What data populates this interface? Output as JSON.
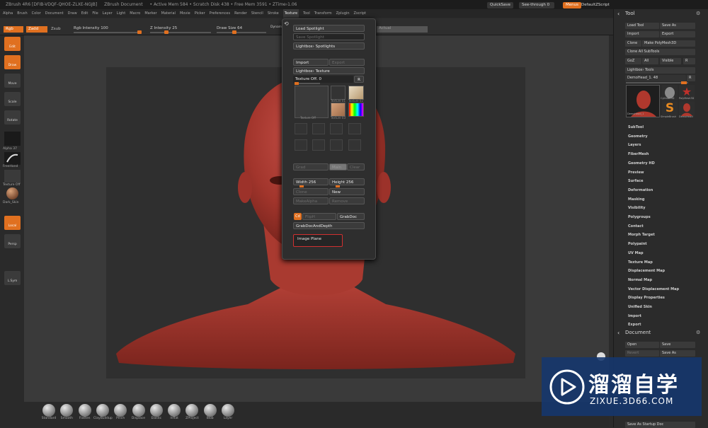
{
  "title_bar": {
    "app": "ZBrush 4R6 [DFIB-VDQF-QHOE-ZLXE-NGJB]",
    "document": "ZBrush Document",
    "stats": "• Active Mem 584 • Scratch Disk 438 • Free Mem 3591 • ZTime›1.06",
    "quicksave": "QuickSave",
    "see_through": "See-through 0",
    "menus": "Menus",
    "default_script": "DefaultZScript"
  },
  "menu_bar": [
    "Alpha",
    "Brush",
    "Color",
    "Document",
    "Draw",
    "Edit",
    "File",
    "Layer",
    "Light",
    "Macro",
    "Marker",
    "Material",
    "Movie",
    "Picker",
    "Preferences",
    "Render",
    "Stencil",
    "Stroke",
    "Texture",
    "Tool",
    "Transform",
    "Zplugin",
    "Zscript"
  ],
  "menu_active": "Texture",
  "toolbar": {
    "rgb": "Rgb",
    "mrgb": "Mrgb",
    "zadd": "Zadd",
    "zsub": "Zsub",
    "zcut": "Zcut",
    "rgb_intensity": "Rgb Intensity 100",
    "z_intensity": "Z Intensity 25",
    "draw_size": "Draw Size 64",
    "dynamic": "Dynamic",
    "focal": "Fo",
    "actual": "Actual"
  },
  "left_shelf": {
    "edit": "Edit",
    "draw": "Draw",
    "move": "Move",
    "scale": "Scale",
    "rotate": "Rotate",
    "alpha": "Alpha 37",
    "freehand": "FreeHand",
    "texture": "Texture Off",
    "material": "Dark_Skin",
    "local": "Local",
    "persp": "Persp",
    "lsym": "L.Sym"
  },
  "texture_popup": {
    "load_spotlight": "Load Spotlight",
    "save_spotlight": "Save Spotlight",
    "lightbox_spotlights": "Lightbox› Spotlights",
    "import": "Import",
    "export": "Export",
    "lightbox_texture": "Lightbox› Texture",
    "texture_off": "Texture Off. 0",
    "r": "R",
    "thumb_labels": [
      "Texture Off",
      "Texture 01",
      "Texture 02",
      "Texture 03"
    ],
    "grad": "Grad",
    "main": "Main",
    "clear": "Clear",
    "width": "Width 256",
    "height": "Height 256",
    "clone": "Clone",
    "new": "New",
    "make_alpha": "MakeAlpha",
    "remove": "Remove",
    "cd": "Cd",
    "flip_h": "FlipH",
    "grab_doc": "GrabDoc",
    "grab_doc_depth": "GrabDocAndDepth",
    "image_plane": "Image Plane"
  },
  "bottom_brushes": [
    "Standard",
    "Smooth",
    "Flatten",
    "ClayBuildup",
    "Pinch",
    "Displace",
    "Elastic",
    "Inflat",
    "ZProject",
    "Blob",
    "Layer"
  ],
  "tool_panel": {
    "header": "Tool",
    "load_tool": "Load Tool",
    "save_as": "Save As",
    "import": "Import",
    "export": "Export",
    "clone": "Clone",
    "make_polymesh": "Make PolyMesh3D",
    "clone_all": "Clone All SubTools",
    "goz": "GoZ",
    "all": "All",
    "visible": "Visible",
    "r": "R",
    "lightbox_tools": "Lightbox› Tools",
    "current_tool": "DemoHead_1. 48",
    "tool_thumbs": [
      "DemoHead_1",
      "Cylinder3D",
      "PolyMesh3D",
      "SimpleBrush",
      "DemoHead"
    ],
    "items": [
      "SubTool",
      "Geometry",
      "Layers",
      "FiberMesh",
      "Geometry HD",
      "Preview",
      "Surface",
      "Deformation",
      "Masking",
      "Visibility",
      "Polygroups",
      "Contact",
      "Morph Target",
      "Polypaint",
      "UV Map",
      "Texture Map",
      "Displacement Map",
      "Normal Map",
      "Vector Displacement Map",
      "Display Properties",
      "Unified Skin",
      "Import",
      "Export"
    ]
  },
  "document_panel": {
    "header": "Document",
    "open": "Open",
    "save": "Save",
    "revert": "Revert",
    "save_as": "Save As",
    "save_as_startup": "Save As Startup Doc"
  },
  "watermark": {
    "brand": "溜溜自学",
    "url": "ZIXUE.3D66.COM"
  },
  "colors": {
    "accent": "#e07020",
    "skin": "#b0382d",
    "panel": "#2e2e2e",
    "highlight_box": "#d03030"
  }
}
